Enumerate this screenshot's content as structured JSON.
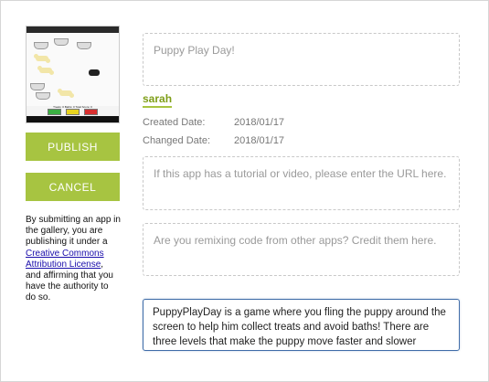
{
  "thumbnail": {
    "score_line": "Treats: 0  Baths: 0  Total Score: 0",
    "levels": [
      {
        "label": "Easy",
        "color": "#3cb043"
      },
      {
        "label": "Medium",
        "color": "#e8d320"
      },
      {
        "label": "Hard",
        "color": "#d83030"
      }
    ]
  },
  "actions": {
    "publish_label": "PUBLISH",
    "cancel_label": "CANCEL"
  },
  "notice": {
    "text_before": "By submitting an app in the gallery, you are publishing it under a ",
    "link_text": "Creative Commons Attribution License",
    "text_after": ", and affirming that you have the authority to do so."
  },
  "form": {
    "title_placeholder": "Puppy Play Day!",
    "author": "sarah",
    "created_label": "Created Date:",
    "created_value": "2018/01/17",
    "changed_label": "Changed Date:",
    "changed_value": "2018/01/17",
    "tutorial_placeholder": "If this app has a tutorial or video, please enter the URL here.",
    "credits_placeholder": "Are you remixing code from other apps? Credit them here.",
    "description": "PuppyPlayDay is a game where you fling the puppy around the screen to help him collect treats and avoid baths! There are three levels that make the puppy move faster and slower"
  },
  "colors": {
    "accent": "#a7c441",
    "focus_border": "#3f6ca8"
  }
}
